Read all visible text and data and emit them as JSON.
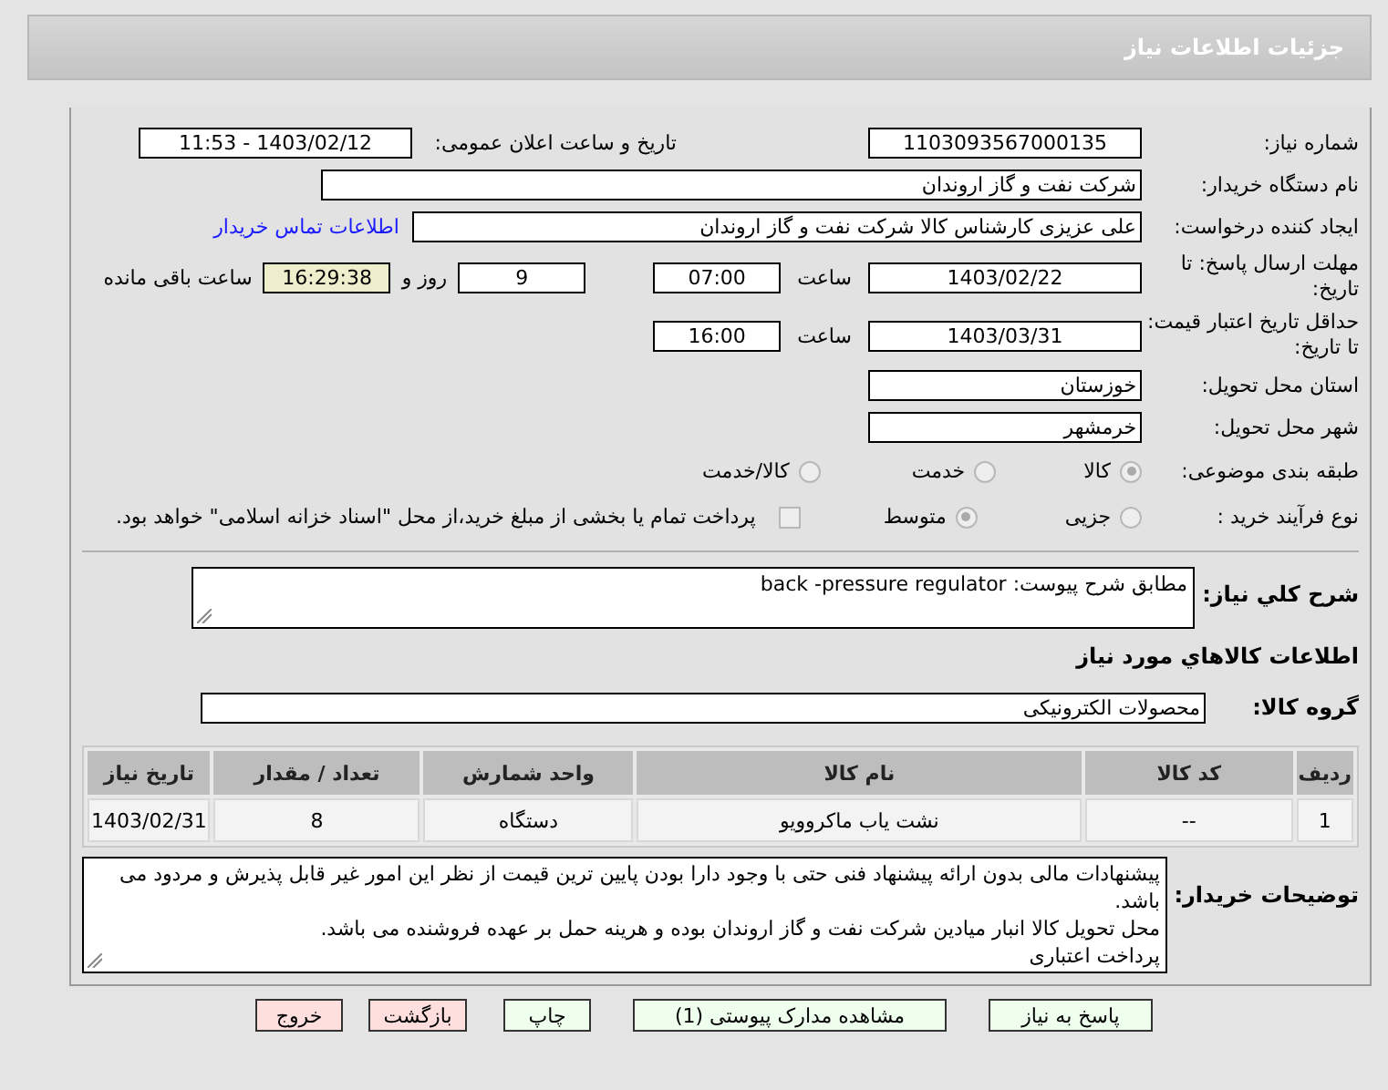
{
  "header": {
    "title": "جزئیات اطلاعات نیاز"
  },
  "request_number": {
    "label": "شماره نیاز:",
    "value": "1103093567000135"
  },
  "announce_datetime": {
    "label": "تاریخ و ساعت اعلان عمومی:",
    "value": "1403/02/12 - 11:53"
  },
  "buyer_org": {
    "label": "نام دستگاه خریدار:",
    "value": "شرکت نفت و گاز اروندان"
  },
  "requester": {
    "label": "ایجاد کننده درخواست:",
    "value": "علی عزیزی کارشناس کالا شرکت نفت و گاز اروندان",
    "link": "اطلاعات تماس خریدار"
  },
  "reply_deadline": {
    "label": "مهلت ارسال پاسخ: تا تاریخ:",
    "date": "1403/02/22",
    "time_label": "ساعت",
    "time": "07:00",
    "days": "9",
    "days_label": "روز و",
    "remaining": "16:29:38",
    "remaining_label": "ساعت باقی مانده"
  },
  "price_validity": {
    "label": "حداقل تاریخ اعتبار قیمت: تا تاریخ:",
    "date": "1403/03/31",
    "time_label": "ساعت",
    "time": "16:00"
  },
  "province": {
    "label": "استان محل تحویل:",
    "value": "خوزستان"
  },
  "city": {
    "label": "شهر محل تحویل:",
    "value": "خرمشهر"
  },
  "category": {
    "label": "طبقه بندی موضوعی:",
    "options": [
      {
        "label": "کالا",
        "selected": true
      },
      {
        "label": "خدمت",
        "selected": false
      },
      {
        "label": "کالا/خدمت",
        "selected": false
      }
    ]
  },
  "process": {
    "label": "نوع فرآیند خرید :",
    "options": [
      {
        "label": "جزیی",
        "selected": false
      },
      {
        "label": "متوسط",
        "selected": true
      }
    ],
    "treasury": {
      "label": "پرداخت تمام یا بخشی از مبلغ خرید،از محل \"اسناد خزانه اسلامی\" خواهد بود.",
      "checked": false
    }
  },
  "description": {
    "label": "شرح کلي نياز:",
    "value": "مطابق شرح پیوست: back -pressure regulator"
  },
  "goods_heading": "اطلاعات کالاهاي مورد نياز",
  "goods_group": {
    "label": "گروه کالا:",
    "value": "محصولات الکترونیکی"
  },
  "table": {
    "columns": [
      "ردیف",
      "کد کالا",
      "نام کالا",
      "واحد شمارش",
      "تعداد / مقدار",
      "تاریخ نیاز"
    ],
    "rows": [
      [
        "1",
        "--",
        "نشت یاب ماکروویو",
        "دستگاه",
        "8",
        "1403/02/31"
      ]
    ]
  },
  "buyer_notes": {
    "label": "توضیحات خریدار:",
    "paragraphs": [
      "پیشنهادات مالی بدون ارائه پیشنهاد فنی حتی با وجود دارا بودن پایین ترین قیمت از نظر این امور غیر قابل پذیرش و مردود می باشد.",
      "محل تحویل کالا انبار میادین شرکت نفت و گاز اروندان بوده و هرینه حمل بر عهده فروشنده می باشد.",
      "پرداخت اعتباری"
    ]
  },
  "buttons": [
    {
      "label": "پاسخ به نیاز",
      "kind": "primary"
    },
    {
      "label": "مشاهده مدارک پیوستی (1)",
      "kind": "primary"
    },
    {
      "label": "چاپ",
      "kind": "primary"
    },
    {
      "label": "بازگشت",
      "kind": "danger"
    },
    {
      "label": "خروج",
      "kind": "danger"
    }
  ]
}
